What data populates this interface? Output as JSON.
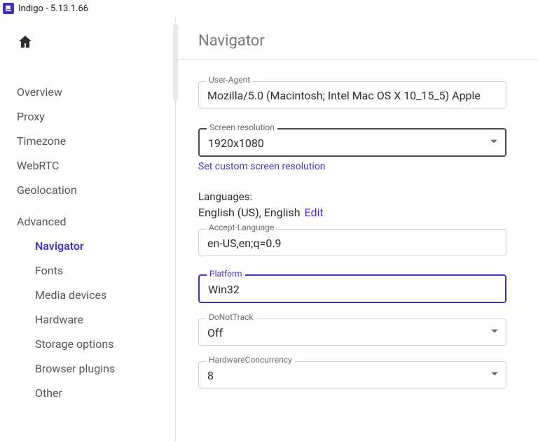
{
  "window": {
    "title": "Indigo - 5.13.1.66"
  },
  "sidebar": {
    "items": [
      {
        "label": "Overview"
      },
      {
        "label": "Proxy"
      },
      {
        "label": "Timezone"
      },
      {
        "label": "WebRTC"
      },
      {
        "label": "Geolocation"
      }
    ],
    "advanced_label": "Advanced",
    "advanced_items": [
      {
        "label": "Navigator",
        "active": true
      },
      {
        "label": "Fonts"
      },
      {
        "label": "Media devices"
      },
      {
        "label": "Hardware"
      },
      {
        "label": "Storage options"
      },
      {
        "label": "Browser plugins"
      },
      {
        "label": "Other"
      }
    ]
  },
  "main": {
    "heading": "Navigator",
    "user_agent": {
      "label": "User-Agent",
      "value": "Mozilla/5.0 (Macintosh; Intel Mac OS X 10_15_5) Apple"
    },
    "screen_resolution": {
      "label": "Screen resolution",
      "value": "1920x1080",
      "custom_link": "Set custom screen resolution"
    },
    "languages": {
      "label": "Languages:",
      "value": "English (US), English",
      "edit_label": "Edit"
    },
    "accept_language": {
      "label": "Accept-Language",
      "value": "en-US,en;q=0.9"
    },
    "platform": {
      "label": "Platform",
      "value": "Win32"
    },
    "do_not_track": {
      "label": "DoNotTrack",
      "value": "Off"
    },
    "hardware_concurrency": {
      "label": "HardwareConcurrency",
      "value": "8"
    }
  }
}
